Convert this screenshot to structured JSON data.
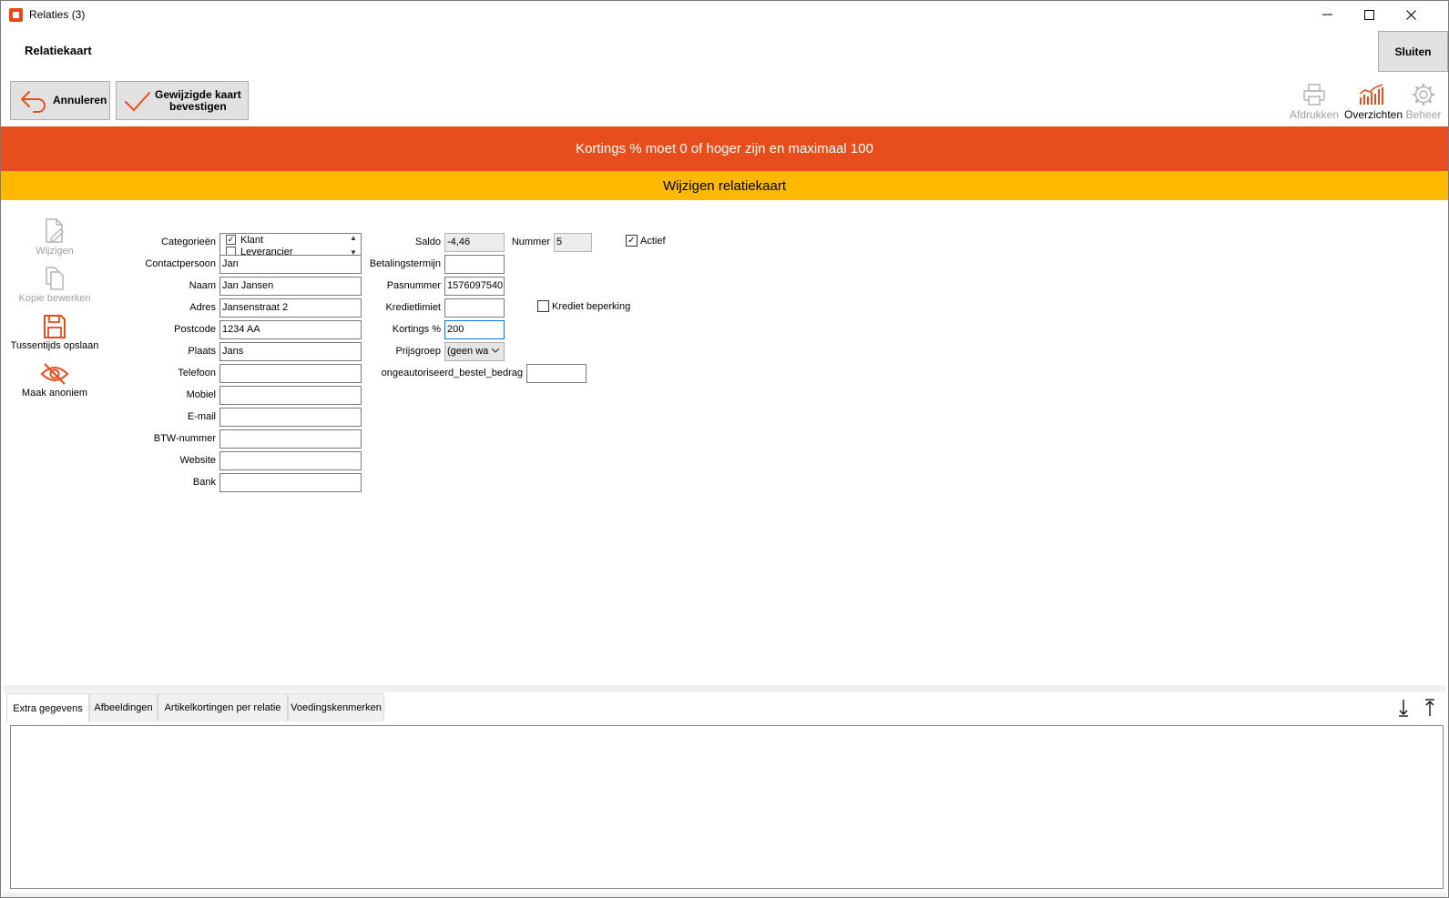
{
  "window": {
    "title": "Relaties (3)",
    "minimize_icon": "minimize-icon",
    "maximize_icon": "maximize-icon",
    "close_icon": "close-icon"
  },
  "header": {
    "heading": "Relatiekaart",
    "close_label": "Sluiten"
  },
  "toolbar": {
    "cancel_label": "Annuleren",
    "confirm_line1": "Gewijzigde kaart",
    "confirm_line2": "bevestigen",
    "print_label": "Afdrukken",
    "overviews_label": "Overzichten",
    "manage_label": "Beheer"
  },
  "banner": {
    "error": "Kortings % moet 0 of hoger zijn en maximaal 100",
    "mode": "Wijzigen relatiekaart"
  },
  "actions": {
    "edit": "Wijzigen",
    "copy_edit": "Kopie bewerken",
    "save_interim": "Tussentijds opslaan",
    "anonymize": "Maak anoniem"
  },
  "form": {
    "categories_label": "Categorieën",
    "categories": [
      {
        "label": "Klant",
        "checked": true
      },
      {
        "label": "Leverancier",
        "checked": false
      }
    ],
    "contact_label": "Contactpersoon",
    "contact_value": "Jan",
    "name_label": "Naam",
    "name_value": "Jan Jansen",
    "address_label": "Adres",
    "address_value": "Jansenstraat 2",
    "postcode_label": "Postcode",
    "postcode_value": "1234 AA",
    "city_label": "Plaats",
    "city_value": "Jans",
    "phone_label": "Telefoon",
    "phone_value": "",
    "mobile_label": "Mobiel",
    "mobile_value": "",
    "email_label": "E-mail",
    "email_value": "",
    "vat_label": "BTW-nummer",
    "vat_value": "",
    "website_label": "Website",
    "website_value": "",
    "bank_label": "Bank",
    "bank_value": "",
    "balance_label": "Saldo",
    "balance_value": "-4,46",
    "number_label": "Nummer",
    "number_value": "5",
    "active_label": "Actief",
    "active_checked": true,
    "payment_term_label": "Betalingstermijn",
    "payment_term_value": "",
    "card_number_label": "Pasnummer",
    "card_number_value": "1576097540",
    "credit_limit_label": "Kredietlimiet",
    "credit_limit_value": "",
    "credit_restriction_label": "Krediet beperking",
    "credit_restriction_checked": false,
    "discount_label": "Kortings %",
    "discount_value": "200",
    "price_group_label": "Prijsgroep",
    "price_group_value": "(geen wa",
    "unauthorized_label": "ongeautoriseerd_bestel_bedrag",
    "unauthorized_value": ""
  },
  "tabs": [
    {
      "label": "Extra gegevens",
      "active": true
    },
    {
      "label": "Afbeeldingen",
      "active": false
    },
    {
      "label": "Artikelkortingen per relatie",
      "active": false
    },
    {
      "label": "Voedingskenmerken",
      "active": false
    }
  ],
  "colors": {
    "accent": "#e84e1d",
    "mode_bar": "#ffb800",
    "disabled_icon": "#b4b4b4"
  }
}
